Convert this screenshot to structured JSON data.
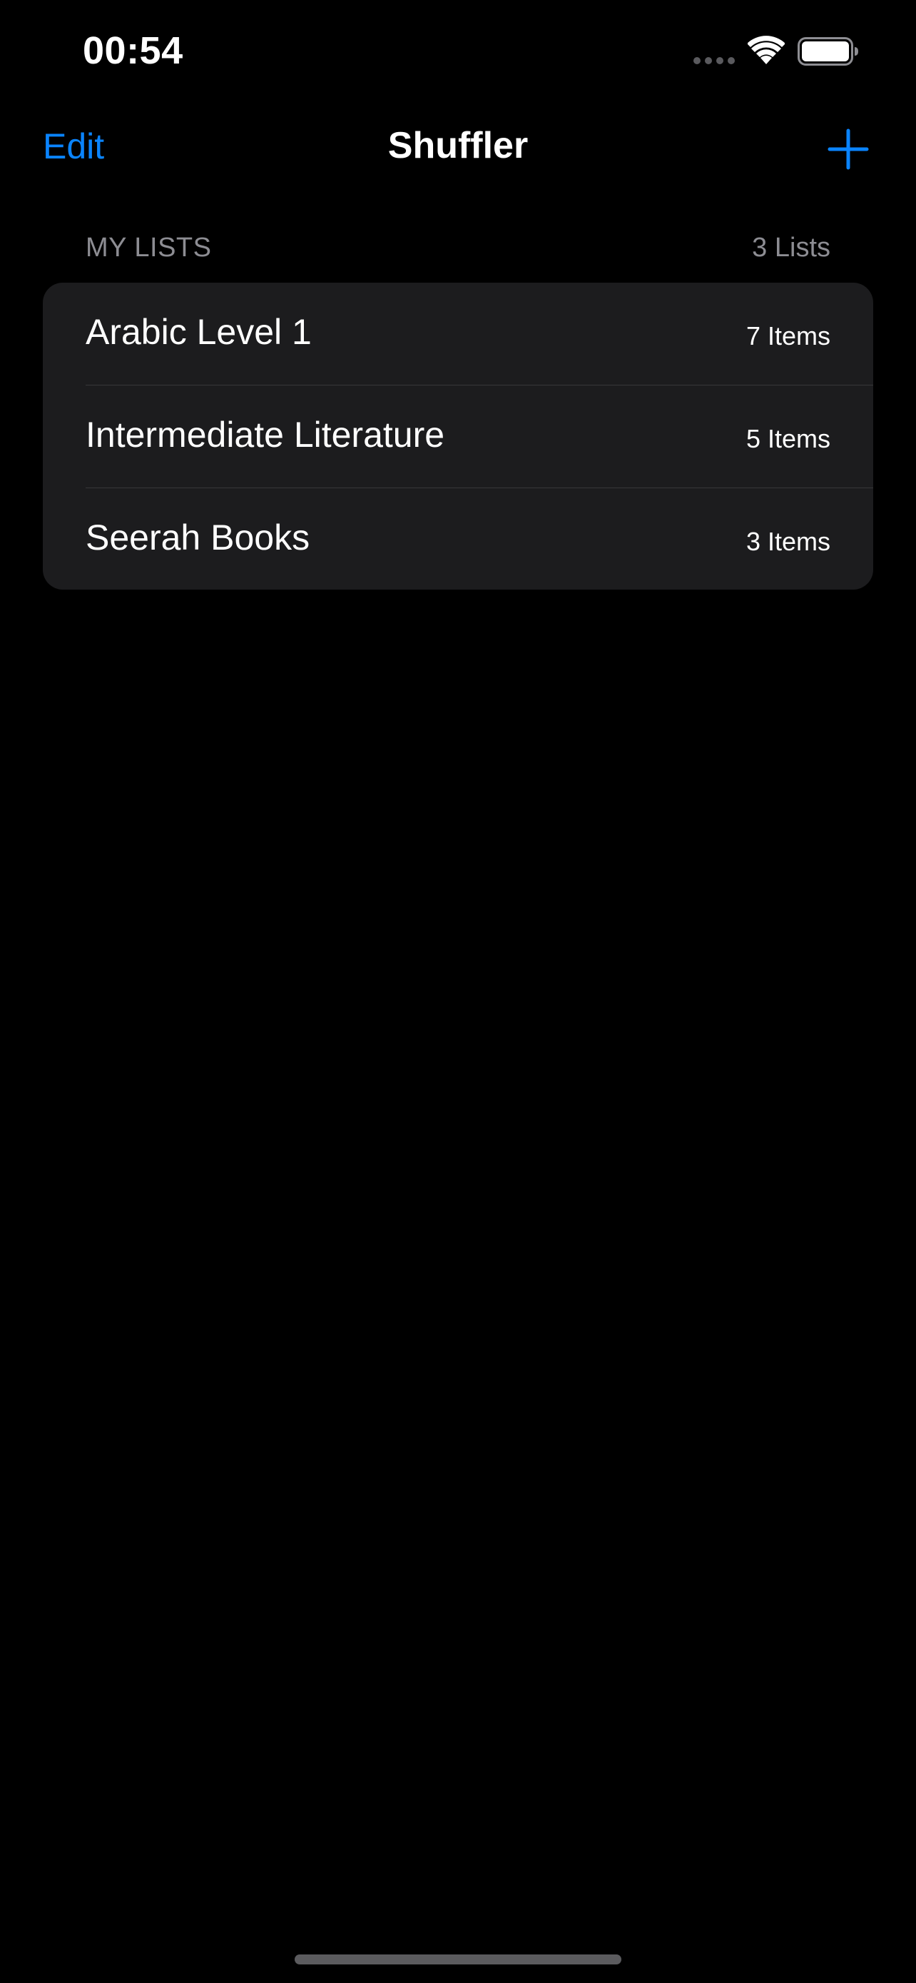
{
  "status_bar": {
    "time": "00:54"
  },
  "nav": {
    "edit_label": "Edit",
    "title": "Shuffler",
    "add_icon": "plus-icon"
  },
  "section": {
    "title": "MY LISTS",
    "count": "3 Lists"
  },
  "lists": [
    {
      "name": "Arabic Level 1",
      "count": "7 Items"
    },
    {
      "name": "Intermediate Literature",
      "count": "5 Items"
    },
    {
      "name": "Seerah Books",
      "count": "3 Items"
    }
  ],
  "colors": {
    "background": "#000000",
    "accent": "#0a84ff",
    "card": "#1c1c1e",
    "secondary_text": "#8d8d93",
    "divider": "#38383a"
  }
}
